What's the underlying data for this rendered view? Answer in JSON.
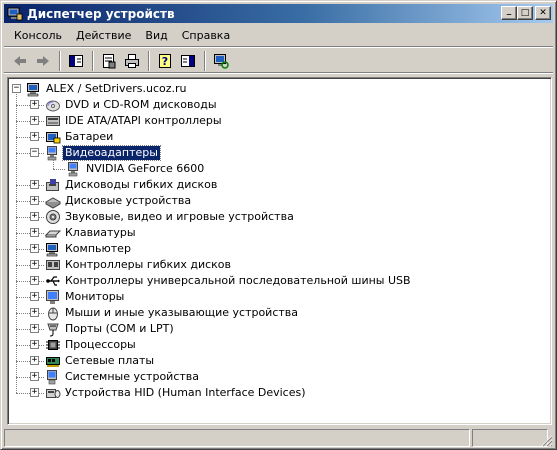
{
  "window": {
    "title": "Диспетчер устройств",
    "minimize_glyph": "_",
    "maximize_glyph": "□",
    "close_glyph": "✕"
  },
  "menu": [
    "Консоль",
    "Действие",
    "Вид",
    "Справка"
  ],
  "toolbar": {
    "icons": [
      "back-arrow-icon",
      "forward-arrow-icon",
      "show-hide-tree-icon",
      "properties-icon",
      "print-icon",
      "help-icon",
      "toggle-view-icon",
      "scan-hardware-icon"
    ]
  },
  "tree": {
    "root": "ALEX / SetDrivers.ucoz.ru",
    "items": [
      {
        "label": "DVD и CD-ROM дисководы",
        "icon": "dvd-drive-icon",
        "expander": "+"
      },
      {
        "label": "IDE ATA/ATAPI контроллеры",
        "icon": "ide-controller-icon",
        "expander": "+"
      },
      {
        "label": "Батареи",
        "icon": "battery-icon",
        "expander": "+"
      },
      {
        "label": "Видеоадаптеры",
        "icon": "display-adapter-icon",
        "expander": "−",
        "selected": true,
        "children": [
          {
            "label": "NVIDIA GeForce 6600",
            "icon": "display-adapter-icon"
          }
        ]
      },
      {
        "label": "Дисководы гибких дисков",
        "icon": "floppy-drive-icon",
        "expander": "+"
      },
      {
        "label": "Дисковые устройства",
        "icon": "disk-drive-icon",
        "expander": "+"
      },
      {
        "label": "Звуковые, видео и игровые устройства",
        "icon": "sound-icon",
        "expander": "+"
      },
      {
        "label": "Клавиатуры",
        "icon": "keyboard-icon",
        "expander": "+"
      },
      {
        "label": "Компьютер",
        "icon": "computer-icon",
        "expander": "+"
      },
      {
        "label": "Контроллеры гибких дисков",
        "icon": "floppy-controller-icon",
        "expander": "+"
      },
      {
        "label": "Контроллеры универсальной последовательной шины USB",
        "icon": "usb-icon",
        "expander": "+"
      },
      {
        "label": "Мониторы",
        "icon": "monitor-icon",
        "expander": "+"
      },
      {
        "label": "Мыши и иные указывающие устройства",
        "icon": "mouse-icon",
        "expander": "+"
      },
      {
        "label": "Порты (COM и LPT)",
        "icon": "port-icon",
        "expander": "+"
      },
      {
        "label": "Процессоры",
        "icon": "processor-icon",
        "expander": "+"
      },
      {
        "label": "Сетевые платы",
        "icon": "network-card-icon",
        "expander": "+"
      },
      {
        "label": "Системные устройства",
        "icon": "system-device-icon",
        "expander": "+"
      },
      {
        "label": "Устройства HID (Human Interface Devices)",
        "icon": "hid-icon",
        "expander": "+"
      }
    ]
  },
  "colors": {
    "titlebar_start": "#0a246a",
    "titlebar_end": "#a6caf0",
    "face": "#d4d0c8",
    "selection": "#0a246a"
  }
}
